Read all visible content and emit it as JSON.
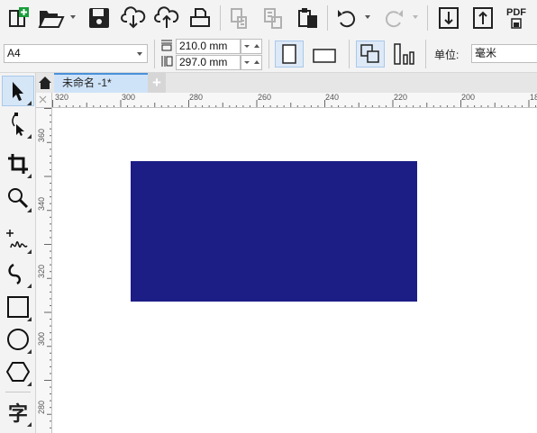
{
  "toolbar": {
    "pdf_label": "PDF",
    "buttons": [
      "new-document",
      "open",
      "save",
      "cloud-download",
      "cloud-upload",
      "print",
      "copy-props",
      "paste-props",
      "clipboard",
      "undo",
      "redo",
      "import",
      "export",
      "publish-pdf"
    ]
  },
  "property_bar": {
    "page_size": "A4",
    "width_value": "210.0 mm",
    "height_value": "297.0 mm",
    "units_label": "单位:",
    "units_value": "毫米"
  },
  "tabs": {
    "document_tab": "未命名 -1*",
    "add_symbol": "+"
  },
  "ruler": {
    "h_labels": [
      "320",
      "300",
      "280",
      "260",
      "240",
      "220",
      "200",
      "18"
    ],
    "v_labels": [
      "360",
      "340",
      "320",
      "300",
      "280"
    ]
  },
  "tools": {
    "text_tool_glyph": "字"
  },
  "canvas": {
    "rectangle_fill": "#1c1e86"
  },
  "colors": {
    "accent": "#4a90d9",
    "tab_active": "#cfe3f8"
  }
}
